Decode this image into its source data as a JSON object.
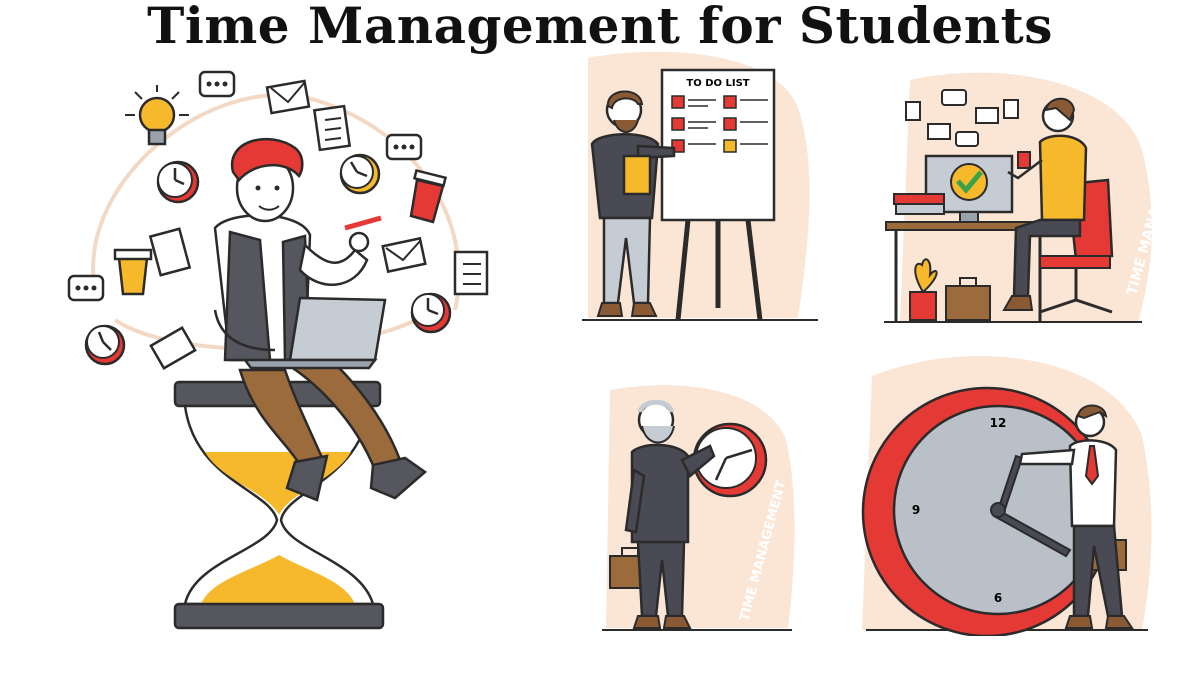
{
  "title": "Time Management for Students",
  "panels": {
    "todo": {
      "board_heading": "TO DO LIST"
    },
    "desk": {
      "watermark": "TIME MANAGEMENT"
    },
    "oldman": {
      "watermark": "TIME MANAGEMENT"
    },
    "bigclock": {
      "numeral_12": "12",
      "numeral_9": "9",
      "numeral_6": "6"
    }
  },
  "colors": {
    "accent_red": "#e53935",
    "accent_yellow": "#f6b92b",
    "background_blob": "#fbe6d6",
    "outline": "#2b2b2b",
    "suit_gray": "#4a4a55",
    "clock_face": "#b9c0c8"
  },
  "icons": [
    "lightbulb-icon",
    "chat-bubble-icon",
    "envelope-icon",
    "checklist-icon",
    "clock-icon",
    "coffee-cup-icon",
    "laptop-icon",
    "hourglass-icon",
    "briefcase-icon",
    "checkmark-icon"
  ]
}
